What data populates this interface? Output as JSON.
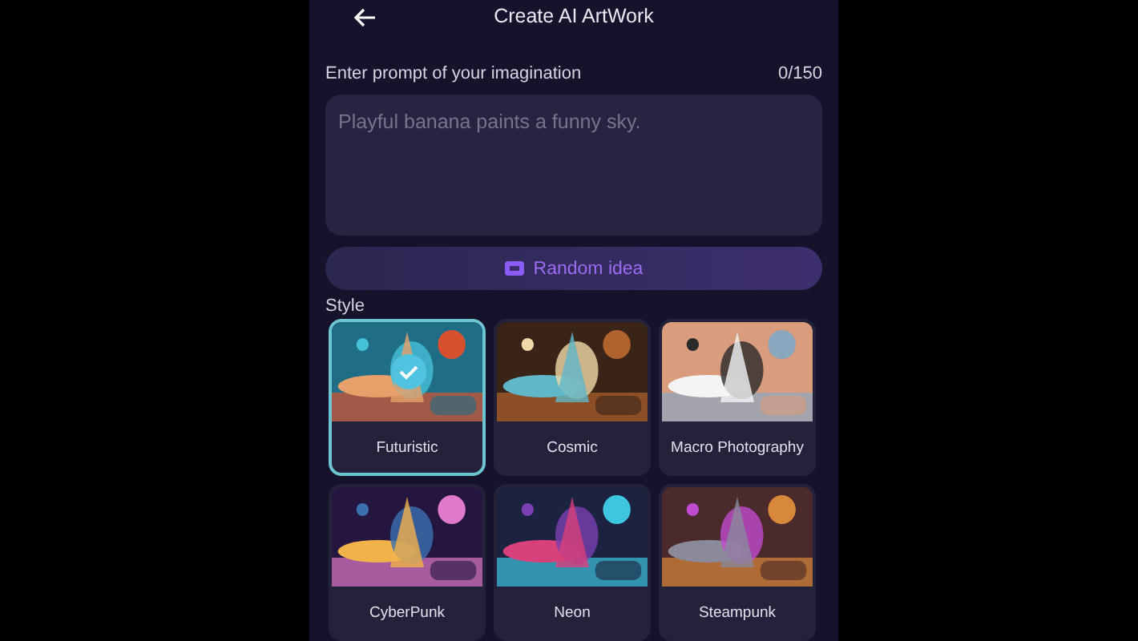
{
  "header": {
    "title": "Create AI ArtWork"
  },
  "prompt": {
    "label": "Enter prompt of your imagination",
    "counter": "0/150",
    "placeholder": "Playful banana paints a funny sky."
  },
  "random_button": {
    "label": "Random idea"
  },
  "style": {
    "label": "Style",
    "options": [
      {
        "label": "Futuristic",
        "selected": true
      },
      {
        "label": "Cosmic",
        "selected": false
      },
      {
        "label": "Macro Photography",
        "selected": false
      },
      {
        "label": "CyberPunk",
        "selected": false
      },
      {
        "label": "Neon",
        "selected": false
      },
      {
        "label": "Steampunk",
        "selected": false
      }
    ]
  }
}
